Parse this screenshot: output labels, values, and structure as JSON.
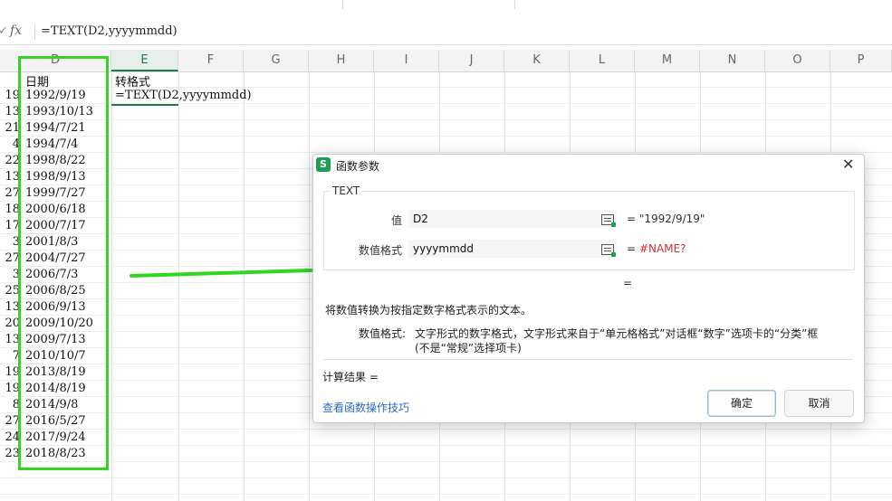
{
  "formula_bar": {
    "fx_label": "fx",
    "formula": "=TEXT(D2,yyyymmdd)"
  },
  "columns": [
    "D",
    "E",
    "F",
    "G",
    "H",
    "I",
    "J",
    "K",
    "L",
    "M",
    "N",
    "O",
    "P"
  ],
  "active_column": "E",
  "sheet": {
    "header_d": "日期",
    "header_e": "转格式",
    "e2_formula": "=TEXT(D2,yyyymmdd)",
    "col_c_fragments": [
      "19",
      "13",
      "21",
      "4",
      "22",
      "13",
      "27",
      "18",
      "17",
      "3",
      "27",
      "3",
      "25",
      "13",
      "20",
      "13",
      "7",
      "19",
      "19",
      "8",
      "27",
      "24",
      "23"
    ],
    "dates": [
      "1992/9/19",
      "1993/10/13",
      "1994/7/21",
      "1994/7/4",
      "1998/8/22",
      "1998/9/13",
      "1999/7/27",
      "2000/6/18",
      "2000/7/17",
      "2001/8/3",
      "2004/7/27",
      "2006/7/3",
      "2006/8/25",
      "2006/9/13",
      "2009/10/20",
      "2009/7/13",
      "2010/10/7",
      "2013/8/19",
      "2014/8/19",
      "2014/9/8",
      "2016/5/27",
      "2017/9/24",
      "2018/8/23"
    ]
  },
  "dialog": {
    "title": "函数参数",
    "icon_letter": "S",
    "function_name": "TEXT",
    "arg1_label": "值",
    "arg1_value": "D2",
    "arg1_result": "= \"1992/9/19\"",
    "arg2_label": "数值格式",
    "arg2_value": "yyyymmdd",
    "arg2_result_prefix": "=",
    "arg2_result": "#NAME?",
    "overall_eq": "=",
    "description": "将数值转换为按指定数字格式表示的文本。",
    "param_label": "数值格式:",
    "param_desc_line1": "文字形式的数字格式，文字形式来自于“单元格格式”对话框“数字”选项卡的“分类”框",
    "param_desc_line2": "(不是“常规”选择项卡)",
    "calc_result_label": "计算结果 =",
    "tips_link": "查看函数操作技巧",
    "ok_label": "确定",
    "cancel_label": "取消"
  },
  "colors": {
    "highlight": "#32d51f",
    "error": "#d32f2f",
    "link": "#2c6bc7",
    "brand": "#1d9e52"
  }
}
